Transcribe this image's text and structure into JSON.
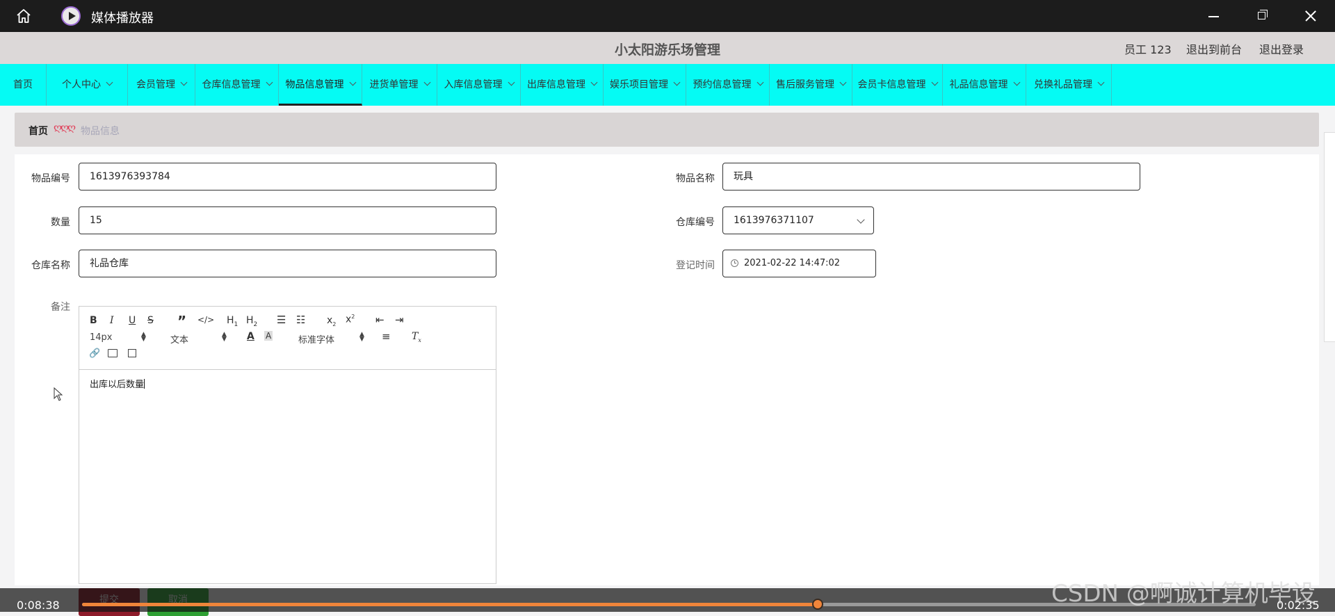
{
  "window": {
    "title": "媒体播放器"
  },
  "header": {
    "app_name": "小太阳游乐场管理",
    "user": "员工 123",
    "front": "退出到前台",
    "logout": "退出登录"
  },
  "nav": {
    "items": [
      {
        "label": "首页",
        "dropdown": false
      },
      {
        "label": "个人中心",
        "dropdown": true
      },
      {
        "label": "会员管理",
        "dropdown": true
      },
      {
        "label": "仓库信息管理",
        "dropdown": true
      },
      {
        "label": "物品信息管理",
        "dropdown": true,
        "active": true
      },
      {
        "label": "进货单管理",
        "dropdown": true
      },
      {
        "label": "入库信息管理",
        "dropdown": true
      },
      {
        "label": "出库信息管理",
        "dropdown": true
      },
      {
        "label": "娱乐项目管理",
        "dropdown": true
      },
      {
        "label": "预约信息管理",
        "dropdown": true
      },
      {
        "label": "售后服务管理",
        "dropdown": true
      },
      {
        "label": "会员卡信息管理",
        "dropdown": true
      },
      {
        "label": "礼品信息管理",
        "dropdown": true
      },
      {
        "label": "兑换礼品管理",
        "dropdown": true
      }
    ]
  },
  "breadcrumb": {
    "home": "首页",
    "separator": "ღღღ",
    "current": "物品信息"
  },
  "form": {
    "item_no": {
      "label": "物品编号",
      "value": "1613976393784"
    },
    "item_name": {
      "label": "物品名称",
      "value": "玩具"
    },
    "quantity": {
      "label": "数量",
      "value": "15"
    },
    "warehouse_no": {
      "label": "仓库编号",
      "value": "1613976371107"
    },
    "warehouse_name": {
      "label": "仓库名称",
      "value": "礼品仓库"
    },
    "register_time": {
      "label": "登记时间",
      "value": "2021-02-22 14:47:02"
    },
    "remark": {
      "label": "备注",
      "value": "出库以后数量"
    }
  },
  "editor": {
    "font_size": "14px",
    "text_style": "文本",
    "font_family": "标准字体"
  },
  "buttons": {
    "submit": "提交",
    "cancel": "取消"
  },
  "player": {
    "elapsed": "0:08:38",
    "total": "0:02:35",
    "progress": 0.627
  },
  "watermark": "CSDN @啊诚计算机毕设",
  "colors": {
    "nav_bg": "#05fbf4",
    "progress": "#f0853a",
    "header_bg": "#dcd8d8"
  }
}
